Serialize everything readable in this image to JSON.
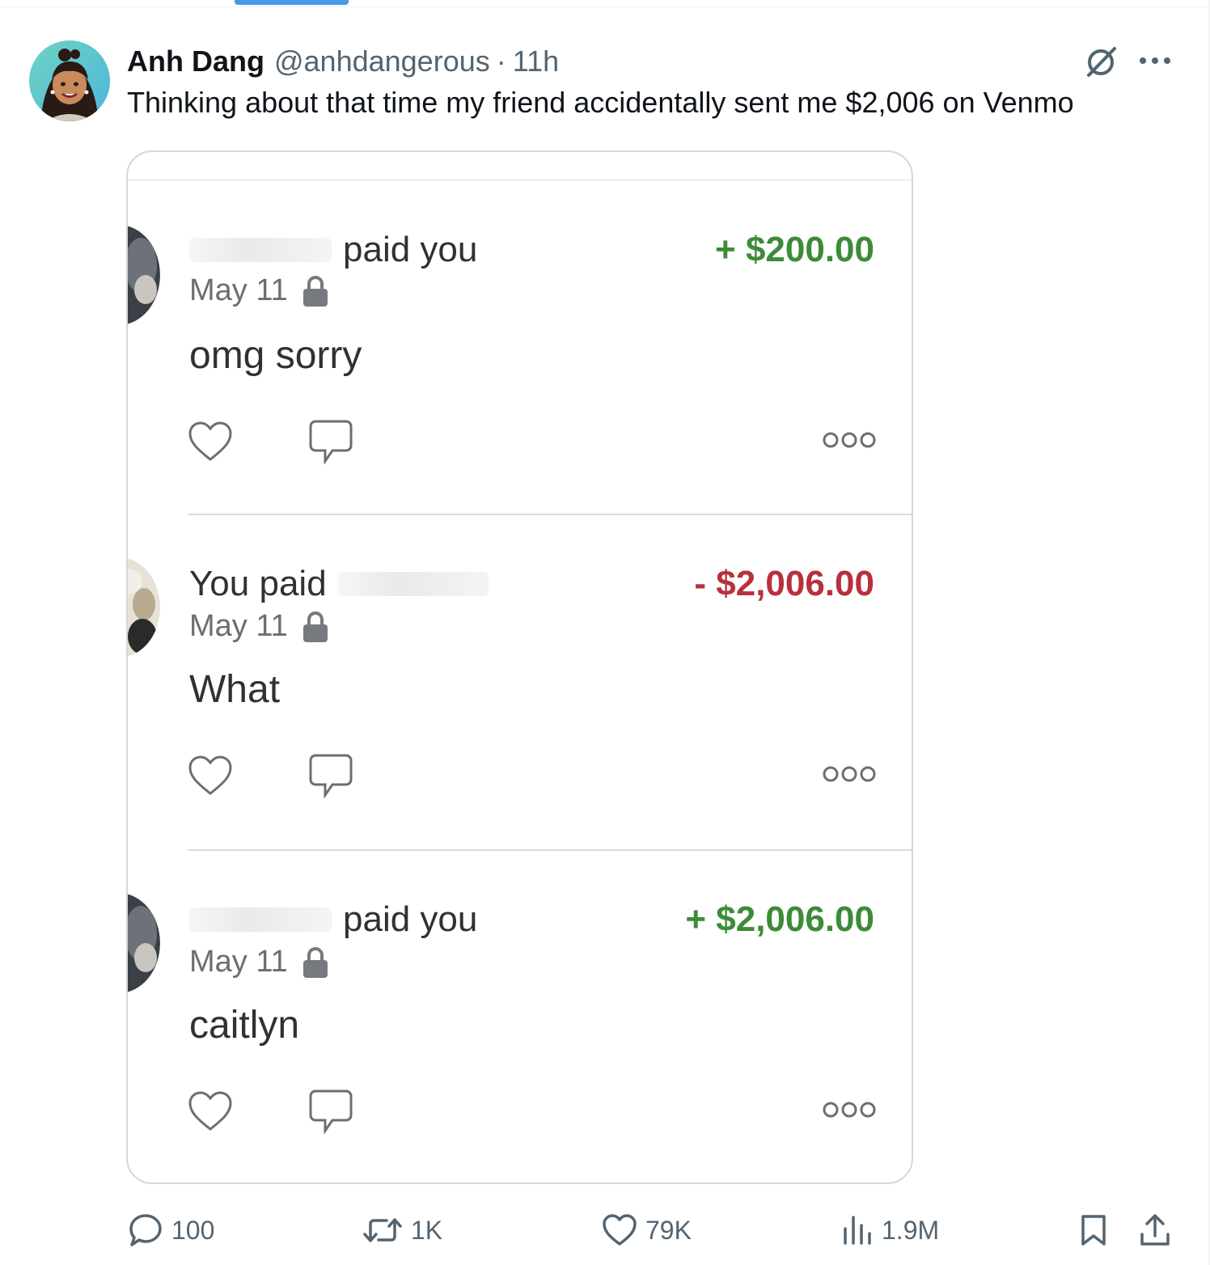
{
  "tweet": {
    "display_name": "Anh Dang",
    "handle": "@anhdangerous",
    "separator": "·",
    "time": "11h",
    "text": "Thinking about that time my friend accidentally sent me $2,006 on Venmo",
    "icons": {
      "grok": "grok-slash-icon",
      "more": "more-horizontal-icon"
    }
  },
  "media": {
    "transactions": [
      {
        "title": "paid you",
        "name_redacted": true,
        "amount": "+ $200.00",
        "direction": "incoming",
        "date": "May 11",
        "note": "omg sorry"
      },
      {
        "title": "You paid",
        "name_redacted": true,
        "amount": "- $2,006.00",
        "direction": "outgoing",
        "date": "May 11",
        "note": "What"
      },
      {
        "title": "paid you",
        "name_redacted": true,
        "amount": "+ $2,006.00",
        "direction": "incoming",
        "date": "May 11",
        "note": "caitlyn"
      }
    ],
    "colors": {
      "incoming": "#3d8b37",
      "outgoing": "#b8303e"
    }
  },
  "actions": {
    "replies": "100",
    "reposts": "1K",
    "likes": "79K",
    "views": "1.9M"
  }
}
